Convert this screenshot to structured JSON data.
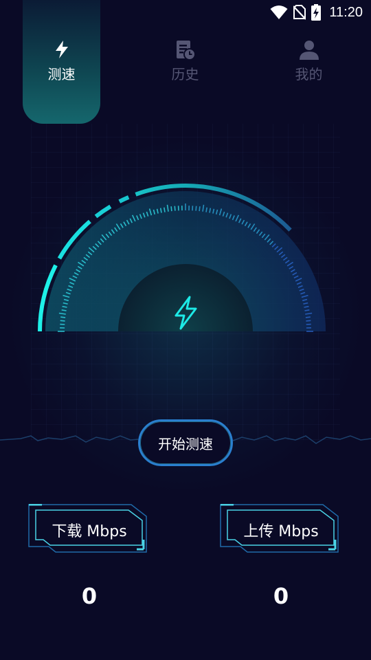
{
  "status_bar": {
    "time": "11:20",
    "icons": [
      "wifi-icon",
      "no-sim-icon",
      "battery-charging-icon"
    ]
  },
  "tabs": [
    {
      "label": "测速",
      "icon": "lightning-icon",
      "active": true
    },
    {
      "label": "历史",
      "icon": "history-icon",
      "active": false
    },
    {
      "label": "我的",
      "icon": "user-icon",
      "active": false
    }
  ],
  "gauge": {
    "center_icon": "lightning-icon",
    "progress_fraction": 0.0
  },
  "start_button": {
    "label": "开始测速"
  },
  "metrics": {
    "download": {
      "label": "下载 Mbps",
      "value": "0"
    },
    "upload": {
      "label": "上传 Mbps",
      "value": "0"
    }
  },
  "colors": {
    "background": "#0a0a26",
    "accent_cyan": "#1de9e6",
    "accent_blue": "#2a7fcf",
    "inactive_text": "#555674"
  }
}
